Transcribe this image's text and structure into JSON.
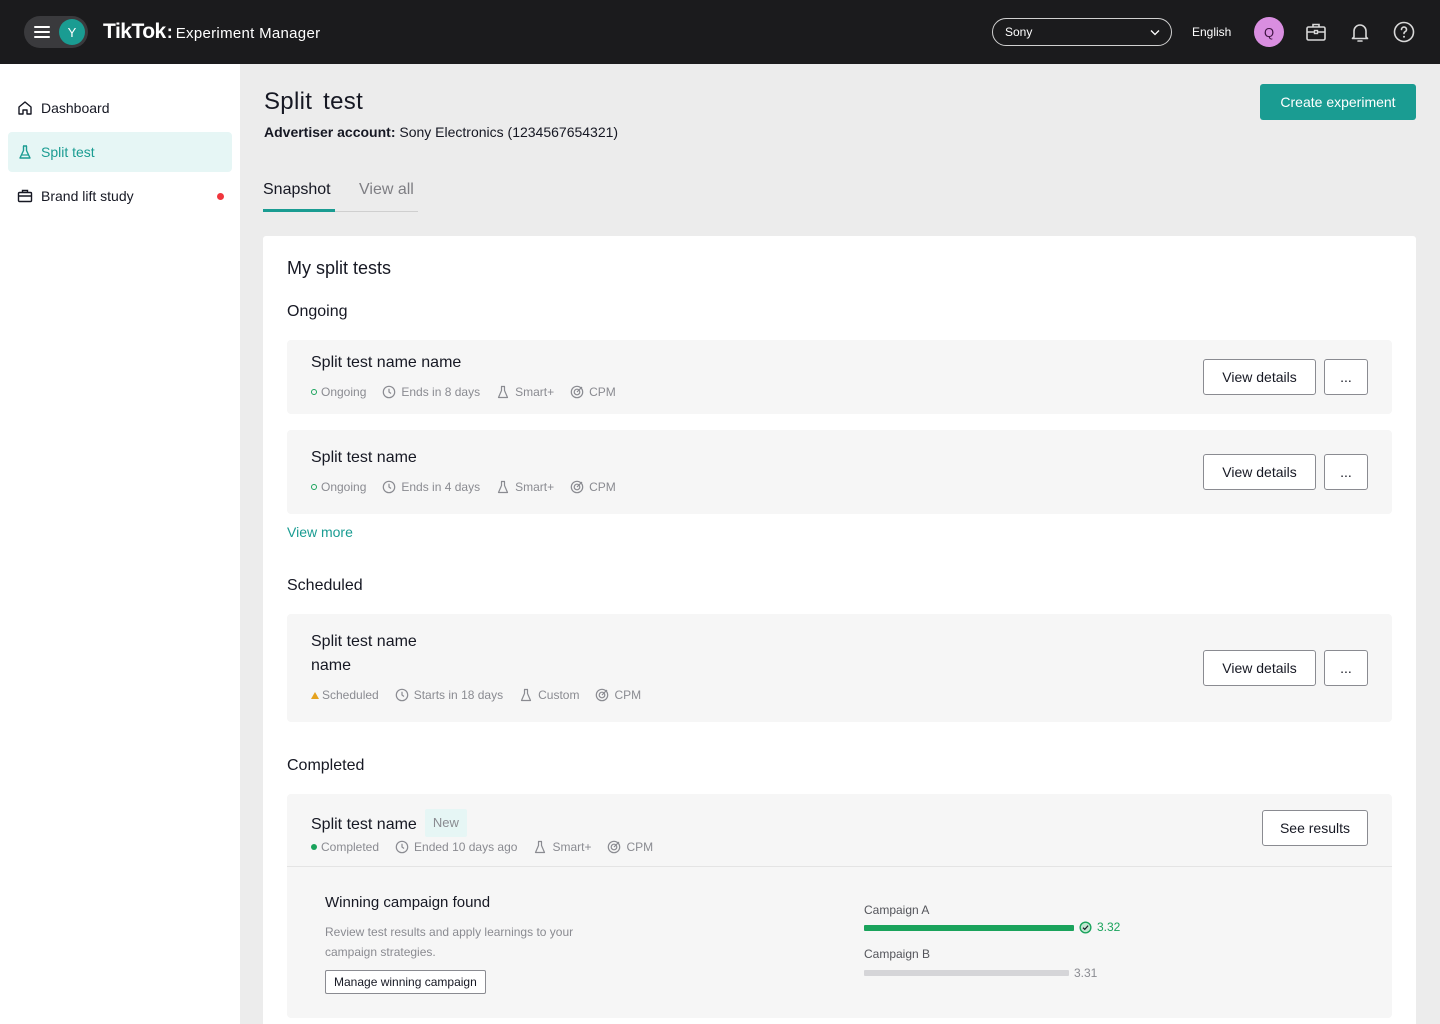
{
  "header": {
    "user_initial": "Y",
    "brand_logo": "TikTok",
    "brand_separator": ":",
    "app_name": "Experiment Manager",
    "account_selected": "Sony",
    "language": "English",
    "profile_initial": "Q",
    "icons": [
      "menu-icon",
      "briefcase-icon",
      "bell-icon",
      "help-icon",
      "chevron-down-icon"
    ]
  },
  "sidebar": {
    "items": [
      {
        "label": "Dashboard",
        "icon": "home-icon"
      },
      {
        "label": "Split test",
        "icon": "flask-icon"
      },
      {
        "label": "Brand lift study",
        "icon": "briefcase-icon"
      }
    ]
  },
  "page": {
    "title": "Split  test",
    "advertiser_label": "Advertiser account:",
    "advertiser_value": "Sony Electronics (1234567654321)",
    "create_button": "Create experiment",
    "tabs": [
      "Snapshot",
      "View all"
    ]
  },
  "card": {
    "title": "My split tests",
    "sections": {
      "ongoing": "Ongoing",
      "scheduled": "Scheduled",
      "completed": "Completed"
    },
    "view_more": "View more",
    "tests": [
      {
        "name": "Split test name name",
        "status": "Ongoing",
        "timing": "Ends in 8 days",
        "type": "Smart+",
        "metric": "CPM"
      },
      {
        "name": "Split test name",
        "status": "Ongoing",
        "timing": "Ends in 4 days",
        "type": "Smart+",
        "metric": "CPM"
      },
      {
        "name_line1": "Split test name",
        "name_line2": "name",
        "status": "Scheduled",
        "timing": "Starts in 18 days",
        "type": "Custom",
        "metric": "CPM"
      },
      {
        "name": "Split test name",
        "badge": "New",
        "status": "Completed",
        "timing": "Ended 10 days ago",
        "type": "Smart+",
        "metric": "CPM"
      }
    ],
    "view_details_label": "View details",
    "more_label": "...",
    "see_results_label": "See results",
    "winner": {
      "title": "Winning campaign found",
      "description": "Review test results and apply learnings to your campaign strategies.",
      "manage_button": "Manage winning campaign",
      "campaigns": [
        {
          "name": "Campaign A",
          "value": "3.32",
          "fill": 1.0
        },
        {
          "name": "Campaign B",
          "value": "3.31",
          "fill": 0.997
        }
      ]
    }
  },
  "colors": {
    "accent": "#1a9c92",
    "topbar": "#1b1b1d",
    "success": "#1aa35c",
    "warning": "#e5a21e",
    "alert": "#f0363d",
    "profile": "#d98ee0"
  }
}
